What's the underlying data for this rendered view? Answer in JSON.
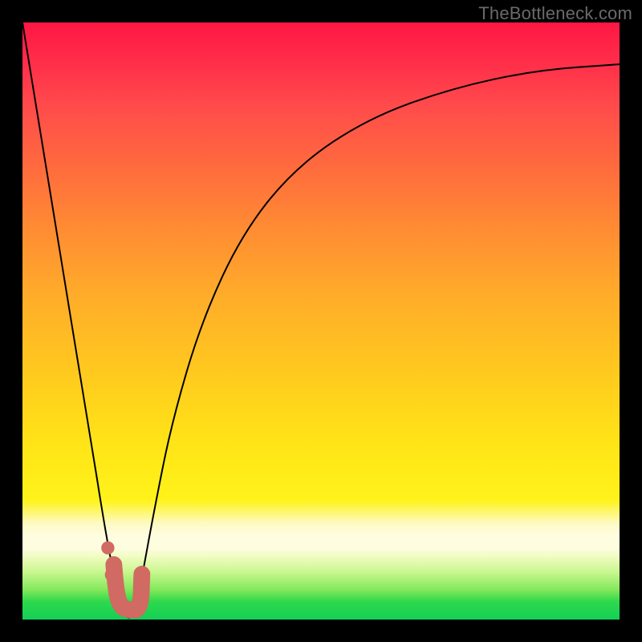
{
  "attribution": "TheBottleneck.com",
  "chart_data": {
    "type": "line",
    "title": "",
    "xlabel": "",
    "ylabel": "",
    "xlim": [
      0,
      100
    ],
    "ylim": [
      0,
      100
    ],
    "series": [
      {
        "name": "bottleneck-curve",
        "x": [
          0,
          5,
          11,
          14,
          16,
          17,
          18,
          19,
          20,
          22,
          25,
          30,
          37,
          46,
          58,
          72,
          86,
          100
        ],
        "values": [
          100,
          69,
          33,
          14,
          4,
          1,
          0,
          2,
          7,
          18,
          33,
          50,
          65,
          76,
          84,
          89,
          92,
          93
        ]
      }
    ],
    "markers": [
      {
        "name": "dot-upper",
        "x": 14.3,
        "y": 12.0,
        "r": 1.1
      },
      {
        "name": "dot-lower",
        "x": 14.9,
        "y": 7.5,
        "r": 1.1
      }
    ],
    "hook": {
      "name": "bottom-hook",
      "points_xy": [
        [
          15.3,
          9.2
        ],
        [
          15.6,
          5.2
        ],
        [
          16.3,
          2.3
        ],
        [
          17.6,
          1.6
        ],
        [
          19.8,
          1.6
        ],
        [
          20.0,
          7.6
        ]
      ],
      "stroke_width": 2.8
    },
    "gradient_stops": [
      {
        "pos": 0.0,
        "color": "#ff1744"
      },
      {
        "pos": 0.34,
        "color": "#ff8a33"
      },
      {
        "pos": 0.7,
        "color": "#ffe317"
      },
      {
        "pos": 0.86,
        "color": "#fffde0"
      },
      {
        "pos": 1.0,
        "color": "#13cf57"
      }
    ]
  }
}
